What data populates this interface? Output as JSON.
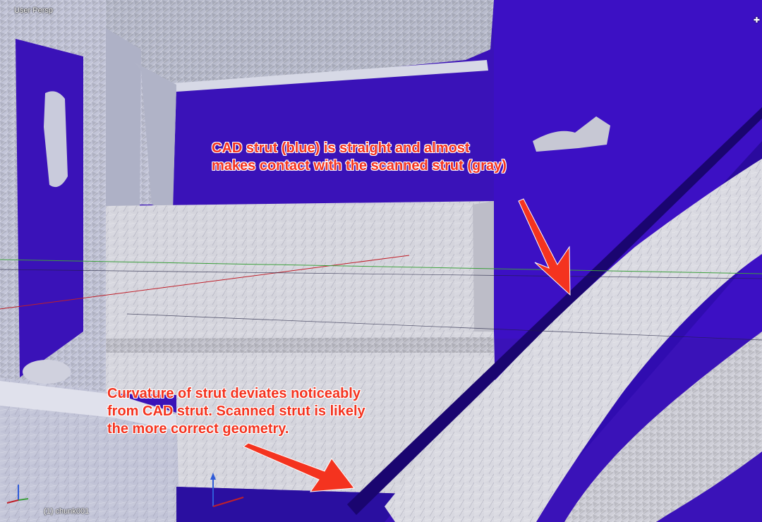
{
  "viewport": {
    "view_label": "User Persp",
    "active_object_label": "(1) chunk001",
    "corner_widget_symbol": "✚"
  },
  "annotations": {
    "top": {
      "line1": "CAD strut (blue) is straight and almost",
      "line2": "makes contact with the scanned strut (gray)"
    },
    "bottom": {
      "line1": "Curvature of strut deviates noticeably",
      "line2": "from CAD strut. Scanned strut is likely",
      "line3": "the more correct geometry."
    }
  },
  "colors": {
    "cad_mesh_blue": "#3a12b8",
    "scanned_mesh_gray": "#c9c9d3",
    "annotation_red": "#f4331f",
    "x_axis_red": "#c0202a",
    "y_axis_green": "#3ca03c",
    "z_axis_blue": "#2f5bd8"
  }
}
